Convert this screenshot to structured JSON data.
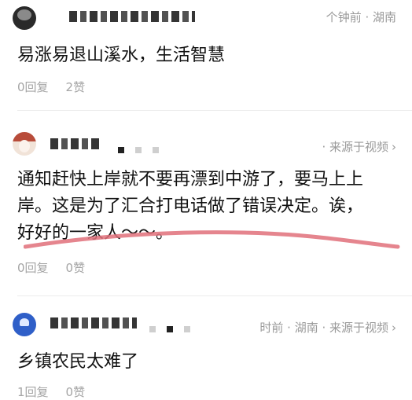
{
  "comments": [
    {
      "meta": "钟前 · 湖南",
      "meta_prefix": "个",
      "text": [
        "易涨易退山溪水，生活智慧"
      ],
      "reply": "0回复",
      "likes": "2赞"
    },
    {
      "meta": "· 来源于视频",
      "text": [
        "通知赶快上岸就不要再漂到中游了，要马上上",
        "岸。这是为了汇合打电话做了错误决定。诶，",
        "好好的一家人～～。"
      ],
      "reply": "0回复",
      "likes": "0赞"
    },
    {
      "meta": "时前 · 湖南 · 来源于视频",
      "text": [
        "乡镇农民太难了"
      ],
      "reply": "1回复",
      "likes": "0赞"
    }
  ],
  "icons": {
    "chevron": "chevron-right-icon"
  },
  "colors": {
    "annotation_underline": "#e0707a",
    "meta": "#9a9a9a"
  }
}
